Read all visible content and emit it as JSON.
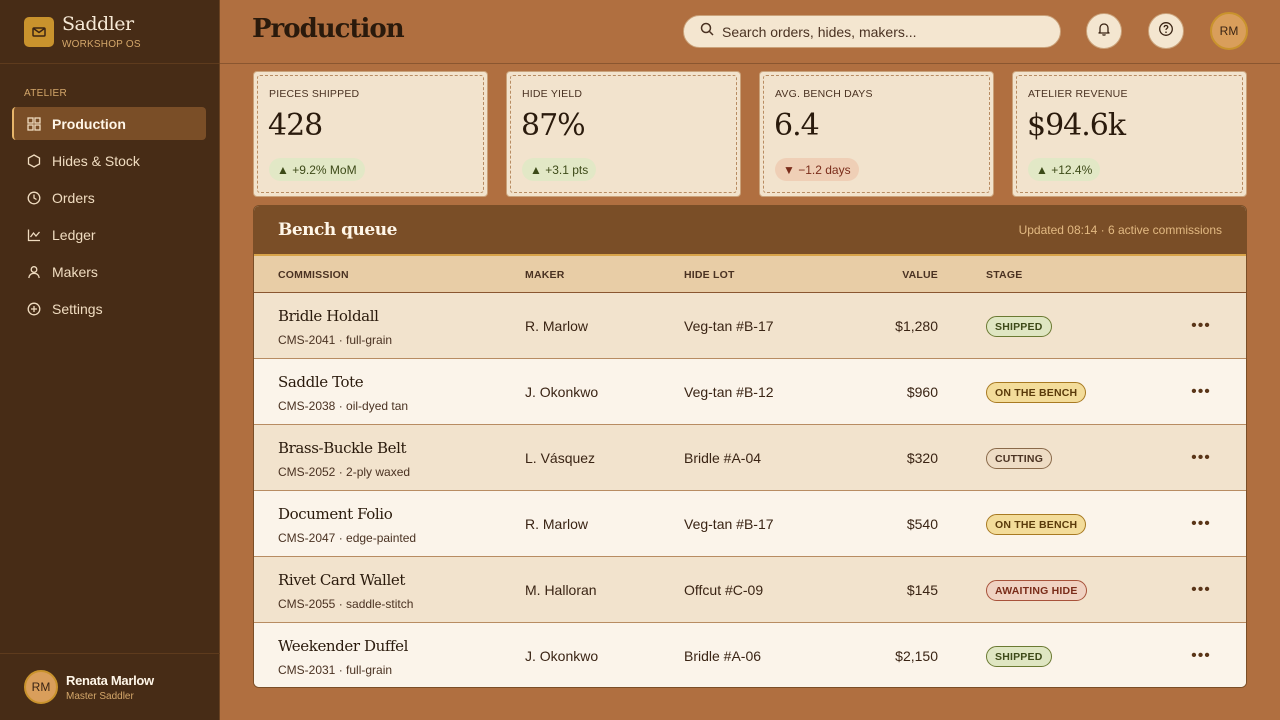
{
  "brand": {
    "name": "Saddler",
    "subtitle": "WORKSHOP OS"
  },
  "sidebar": {
    "section_label": "ATELIER",
    "items": [
      {
        "label": "Production",
        "icon": "grid-icon",
        "active": true
      },
      {
        "label": "Hides & Stock",
        "icon": "hexagon-icon",
        "active": false
      },
      {
        "label": "Orders",
        "icon": "clock-icon",
        "active": false
      },
      {
        "label": "Ledger",
        "icon": "chart-line-icon",
        "active": false
      },
      {
        "label": "Makers",
        "icon": "user-icon",
        "active": false
      },
      {
        "label": "Settings",
        "icon": "plus-circle-icon",
        "active": false
      }
    ],
    "user": {
      "initials": "RM",
      "name": "Renata Marlow",
      "role": "Master Saddler"
    }
  },
  "header": {
    "title": "Production",
    "search_placeholder": "Search orders, hides, makers...",
    "avatar_initials": "RM"
  },
  "kpis": [
    {
      "label": "PIECES SHIPPED",
      "value": "428",
      "delta": "▲ +9.2% MoM",
      "trend": "up"
    },
    {
      "label": "HIDE YIELD",
      "value": "87%",
      "delta": "▲ +3.1 pts",
      "trend": "up"
    },
    {
      "label": "AVG. BENCH DAYS",
      "value": "6.4",
      "delta": "▼ −1.2 days",
      "trend": "down"
    },
    {
      "label": "ATELIER REVENUE",
      "value": "$94.6k",
      "delta": "▲ +12.4%",
      "trend": "up"
    }
  ],
  "queue": {
    "title": "Bench queue",
    "meta": "Updated 08:14 · 6 active commissions",
    "columns": [
      "COMMISSION",
      "MAKER",
      "HIDE LOT",
      "VALUE",
      "STAGE"
    ],
    "rows": [
      {
        "name": "Bridle Holdall",
        "sub": "CMS-2041 · full-grain",
        "maker": "R. Marlow",
        "lot": "Veg-tan #B-17",
        "value": "$1,280",
        "stage": "SHIPPED",
        "stage_type": "shipped"
      },
      {
        "name": "Saddle Tote",
        "sub": "CMS-2038 · oil-dyed tan",
        "maker": "J. Okonkwo",
        "lot": "Veg-tan #B-12",
        "value": "$960",
        "stage": "ON THE BENCH",
        "stage_type": "bench"
      },
      {
        "name": "Brass-Buckle Belt",
        "sub": "CMS-2052 · 2-ply waxed",
        "maker": "L. Vásquez",
        "lot": "Bridle #A-04",
        "value": "$320",
        "stage": "CUTTING",
        "stage_type": "cutting"
      },
      {
        "name": "Document Folio",
        "sub": "CMS-2047 · edge-painted",
        "maker": "R. Marlow",
        "lot": "Veg-tan #B-17",
        "value": "$540",
        "stage": "ON THE BENCH",
        "stage_type": "bench"
      },
      {
        "name": "Rivet Card Wallet",
        "sub": "CMS-2055 · saddle-stitch",
        "maker": "M. Halloran",
        "lot": "Offcut #C-09",
        "value": "$145",
        "stage": "AWAITING HIDE",
        "stage_type": "awaiting"
      },
      {
        "name": "Weekender Duffel",
        "sub": "CMS-2031 · full-grain",
        "maker": "J. Okonkwo",
        "lot": "Bridle #A-06",
        "value": "$2,150",
        "stage": "SHIPPED",
        "stage_type": "shipped"
      }
    ]
  },
  "colors": {
    "shipped": "#dfe6c2",
    "shipped_text": "#3d4a18",
    "shipped_border": "#6b7a32",
    "bench": "#f3dc9a",
    "bench_text": "#5a3a0a",
    "bench_border": "#a87a22",
    "cutting": "#eedcc4",
    "cutting_text": "#4a3222",
    "cutting_border": "#8a6a4a",
    "awaiting": "#f0d2c2",
    "awaiting_text": "#7a2c1a",
    "awaiting_border": "#a8523a"
  }
}
